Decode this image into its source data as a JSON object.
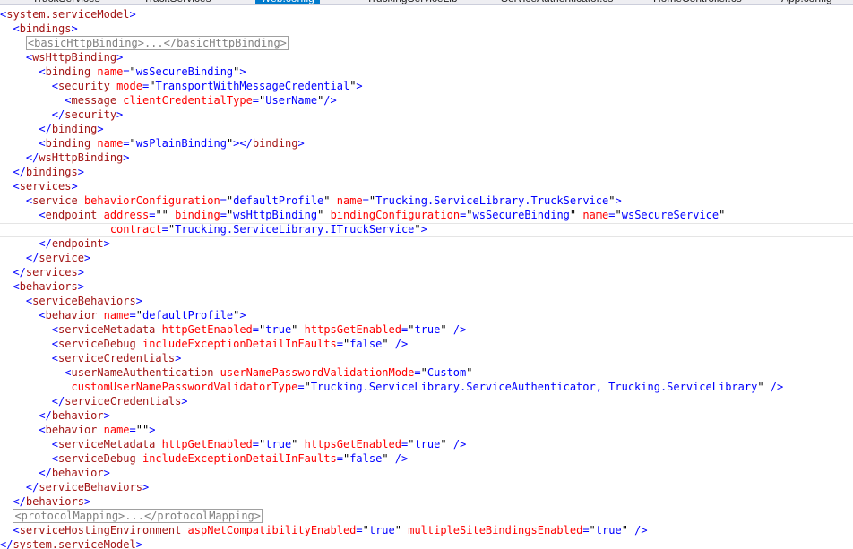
{
  "tabs": [
    {
      "label": "TruckServices",
      "active": false
    },
    {
      "label": "TrackServices",
      "active": false
    },
    {
      "label": "Web.config",
      "active": true
    },
    {
      "label": "TruckingServiceLib",
      "active": false
    },
    {
      "label": "ServiceAuthenticator.cs",
      "active": false
    },
    {
      "label": "HomeController.cs",
      "active": false
    },
    {
      "label": "App.config",
      "active": false
    }
  ],
  "code_lines": [
    [
      [
        "dl",
        "<"
      ],
      [
        "tg",
        "system.serviceModel"
      ],
      [
        "dl",
        ">"
      ]
    ],
    [
      [
        "sp",
        "  "
      ],
      [
        "dl",
        "<"
      ],
      [
        "tg",
        "bindings"
      ],
      [
        "dl",
        ">"
      ]
    ],
    [
      [
        "sp",
        "    "
      ],
      [
        "co",
        "<basicHttpBinding>...</basicHttpBinding>"
      ]
    ],
    [
      [
        "sp",
        "    "
      ],
      [
        "dl",
        "<"
      ],
      [
        "tg",
        "wsHttpBinding"
      ],
      [
        "dl",
        ">"
      ]
    ],
    [
      [
        "sp",
        "      "
      ],
      [
        "dl",
        "<"
      ],
      [
        "tg",
        "binding"
      ],
      [
        "sp",
        " "
      ],
      [
        "at",
        "name"
      ],
      [
        "eq",
        "="
      ],
      [
        "tx",
        "\""
      ],
      [
        "vl",
        "wsSecureBinding"
      ],
      [
        "tx",
        "\""
      ],
      [
        "dl",
        ">"
      ]
    ],
    [
      [
        "sp",
        "        "
      ],
      [
        "dl",
        "<"
      ],
      [
        "tg",
        "security"
      ],
      [
        "sp",
        " "
      ],
      [
        "at",
        "mode"
      ],
      [
        "eq",
        "="
      ],
      [
        "tx",
        "\""
      ],
      [
        "vl",
        "TransportWithMessageCredential"
      ],
      [
        "tx",
        "\""
      ],
      [
        "dl",
        ">"
      ]
    ],
    [
      [
        "sp",
        "          "
      ],
      [
        "dl",
        "<"
      ],
      [
        "tg",
        "message"
      ],
      [
        "sp",
        " "
      ],
      [
        "at",
        "clientCredentialType"
      ],
      [
        "eq",
        "="
      ],
      [
        "tx",
        "\""
      ],
      [
        "vl",
        "UserName"
      ],
      [
        "tx",
        "\""
      ],
      [
        "dl",
        "/>"
      ]
    ],
    [
      [
        "sp",
        "        "
      ],
      [
        "dl",
        "</"
      ],
      [
        "tg",
        "security"
      ],
      [
        "dl",
        ">"
      ]
    ],
    [
      [
        "sp",
        "      "
      ],
      [
        "dl",
        "</"
      ],
      [
        "tg",
        "binding"
      ],
      [
        "dl",
        ">"
      ]
    ],
    [
      [
        "sp",
        "      "
      ],
      [
        "dl",
        "<"
      ],
      [
        "tg",
        "binding"
      ],
      [
        "sp",
        " "
      ],
      [
        "at",
        "name"
      ],
      [
        "eq",
        "="
      ],
      [
        "tx",
        "\""
      ],
      [
        "vl",
        "wsPlainBinding"
      ],
      [
        "tx",
        "\""
      ],
      [
        "dl",
        "></"
      ],
      [
        "tg",
        "binding"
      ],
      [
        "dl",
        ">"
      ]
    ],
    [
      [
        "sp",
        "    "
      ],
      [
        "dl",
        "</"
      ],
      [
        "tg",
        "wsHttpBinding"
      ],
      [
        "dl",
        ">"
      ]
    ],
    [
      [
        "sp",
        "  "
      ],
      [
        "dl",
        "</"
      ],
      [
        "tg",
        "bindings"
      ],
      [
        "dl",
        ">"
      ]
    ],
    [
      [
        "sp",
        "  "
      ],
      [
        "dl",
        "<"
      ],
      [
        "tg",
        "services"
      ],
      [
        "dl",
        ">"
      ]
    ],
    [
      [
        "sp",
        "    "
      ],
      [
        "dl",
        "<"
      ],
      [
        "tg",
        "service"
      ],
      [
        "sp",
        " "
      ],
      [
        "at",
        "behaviorConfiguration"
      ],
      [
        "eq",
        "="
      ],
      [
        "tx",
        "\""
      ],
      [
        "vl",
        "defaultProfile"
      ],
      [
        "tx",
        "\""
      ],
      [
        "sp",
        " "
      ],
      [
        "at",
        "name"
      ],
      [
        "eq",
        "="
      ],
      [
        "tx",
        "\""
      ],
      [
        "vl",
        "Trucking.ServiceLibrary.TruckService"
      ],
      [
        "tx",
        "\""
      ],
      [
        "dl",
        ">"
      ]
    ],
    [
      [
        "sp",
        "      "
      ],
      [
        "dl",
        "<"
      ],
      [
        "tg",
        "endpoint"
      ],
      [
        "sp",
        " "
      ],
      [
        "at",
        "address"
      ],
      [
        "eq",
        "="
      ],
      [
        "tx",
        "\"\""
      ],
      [
        "sp",
        " "
      ],
      [
        "at",
        "binding"
      ],
      [
        "eq",
        "="
      ],
      [
        "tx",
        "\""
      ],
      [
        "vl",
        "wsHttpBinding"
      ],
      [
        "tx",
        "\""
      ],
      [
        "sp",
        " "
      ],
      [
        "at",
        "bindingConfiguration"
      ],
      [
        "eq",
        "="
      ],
      [
        "tx",
        "\""
      ],
      [
        "vl",
        "wsSecureBinding"
      ],
      [
        "tx",
        "\""
      ],
      [
        "sp",
        " "
      ],
      [
        "at",
        "name"
      ],
      [
        "eq",
        "="
      ],
      [
        "tx",
        "\""
      ],
      [
        "vl",
        "wsSecureService"
      ],
      [
        "tx",
        "\""
      ]
    ],
    [
      [
        "sp",
        "                 "
      ],
      [
        "at",
        "contract"
      ],
      [
        "eq",
        "="
      ],
      [
        "tx",
        "\""
      ],
      [
        "vl",
        "Trucking.ServiceLibrary.ITruckService"
      ],
      [
        "tx",
        "\""
      ],
      [
        "dl",
        ">"
      ]
    ],
    [
      [
        "sp",
        "      "
      ],
      [
        "dl",
        "</"
      ],
      [
        "tg",
        "endpoint"
      ],
      [
        "dl",
        ">"
      ]
    ],
    [
      [
        "sp",
        "    "
      ],
      [
        "dl",
        "</"
      ],
      [
        "tg",
        "service"
      ],
      [
        "dl",
        ">"
      ]
    ],
    [
      [
        "sp",
        "  "
      ],
      [
        "dl",
        "</"
      ],
      [
        "tg",
        "services"
      ],
      [
        "dl",
        ">"
      ]
    ],
    [
      [
        "sp",
        "  "
      ],
      [
        "dl",
        "<"
      ],
      [
        "tg",
        "behaviors"
      ],
      [
        "dl",
        ">"
      ]
    ],
    [
      [
        "sp",
        "    "
      ],
      [
        "dl",
        "<"
      ],
      [
        "tg",
        "serviceBehaviors"
      ],
      [
        "dl",
        ">"
      ]
    ],
    [
      [
        "sp",
        "      "
      ],
      [
        "dl",
        "<"
      ],
      [
        "tg",
        "behavior"
      ],
      [
        "sp",
        " "
      ],
      [
        "at",
        "name"
      ],
      [
        "eq",
        "="
      ],
      [
        "tx",
        "\""
      ],
      [
        "vl",
        "defaultProfile"
      ],
      [
        "tx",
        "\""
      ],
      [
        "dl",
        ">"
      ]
    ],
    [
      [
        "sp",
        "        "
      ],
      [
        "dl",
        "<"
      ],
      [
        "tg",
        "serviceMetadata"
      ],
      [
        "sp",
        " "
      ],
      [
        "at",
        "httpGetEnabled"
      ],
      [
        "eq",
        "="
      ],
      [
        "tx",
        "\""
      ],
      [
        "vl",
        "true"
      ],
      [
        "tx",
        "\""
      ],
      [
        "sp",
        " "
      ],
      [
        "at",
        "httpsGetEnabled"
      ],
      [
        "eq",
        "="
      ],
      [
        "tx",
        "\""
      ],
      [
        "vl",
        "true"
      ],
      [
        "tx",
        "\""
      ],
      [
        "sp",
        " "
      ],
      [
        "dl",
        "/>"
      ]
    ],
    [
      [
        "sp",
        "        "
      ],
      [
        "dl",
        "<"
      ],
      [
        "tg",
        "serviceDebug"
      ],
      [
        "sp",
        " "
      ],
      [
        "at",
        "includeExceptionDetailInFaults"
      ],
      [
        "eq",
        "="
      ],
      [
        "tx",
        "\""
      ],
      [
        "vl",
        "false"
      ],
      [
        "tx",
        "\""
      ],
      [
        "sp",
        " "
      ],
      [
        "dl",
        "/>"
      ]
    ],
    [
      [
        "sp",
        "        "
      ],
      [
        "dl",
        "<"
      ],
      [
        "tg",
        "serviceCredentials"
      ],
      [
        "dl",
        ">"
      ]
    ],
    [
      [
        "sp",
        "          "
      ],
      [
        "dl",
        "<"
      ],
      [
        "tg",
        "userNameAuthentication"
      ],
      [
        "sp",
        " "
      ],
      [
        "at",
        "userNamePasswordValidationMode"
      ],
      [
        "eq",
        "="
      ],
      [
        "tx",
        "\""
      ],
      [
        "vl",
        "Custom"
      ],
      [
        "tx",
        "\""
      ]
    ],
    [
      [
        "sp",
        "           "
      ],
      [
        "at",
        "customUserNamePasswordValidatorType"
      ],
      [
        "eq",
        "="
      ],
      [
        "tx",
        "\""
      ],
      [
        "vl",
        "Trucking.ServiceLibrary.ServiceAuthenticator, Trucking.ServiceLibrary"
      ],
      [
        "tx",
        "\""
      ],
      [
        "sp",
        " "
      ],
      [
        "dl",
        "/>"
      ]
    ],
    [
      [
        "sp",
        "        "
      ],
      [
        "dl",
        "</"
      ],
      [
        "tg",
        "serviceCredentials"
      ],
      [
        "dl",
        ">"
      ]
    ],
    [
      [
        "sp",
        "      "
      ],
      [
        "dl",
        "</"
      ],
      [
        "tg",
        "behavior"
      ],
      [
        "dl",
        ">"
      ]
    ],
    [
      [
        "sp",
        "      "
      ],
      [
        "dl",
        "<"
      ],
      [
        "tg",
        "behavior"
      ],
      [
        "sp",
        " "
      ],
      [
        "at",
        "name"
      ],
      [
        "eq",
        "="
      ],
      [
        "tx",
        "\"\""
      ],
      [
        "dl",
        ">"
      ]
    ],
    [
      [
        "sp",
        "        "
      ],
      [
        "dl",
        "<"
      ],
      [
        "tg",
        "serviceMetadata"
      ],
      [
        "sp",
        " "
      ],
      [
        "at",
        "httpGetEnabled"
      ],
      [
        "eq",
        "="
      ],
      [
        "tx",
        "\""
      ],
      [
        "vl",
        "true"
      ],
      [
        "tx",
        "\""
      ],
      [
        "sp",
        " "
      ],
      [
        "at",
        "httpsGetEnabled"
      ],
      [
        "eq",
        "="
      ],
      [
        "tx",
        "\""
      ],
      [
        "vl",
        "true"
      ],
      [
        "tx",
        "\""
      ],
      [
        "sp",
        " "
      ],
      [
        "dl",
        "/>"
      ]
    ],
    [
      [
        "sp",
        "        "
      ],
      [
        "dl",
        "<"
      ],
      [
        "tg",
        "serviceDebug"
      ],
      [
        "sp",
        " "
      ],
      [
        "at",
        "includeExceptionDetailInFaults"
      ],
      [
        "eq",
        "="
      ],
      [
        "tx",
        "\""
      ],
      [
        "vl",
        "false"
      ],
      [
        "tx",
        "\""
      ],
      [
        "sp",
        " "
      ],
      [
        "dl",
        "/>"
      ]
    ],
    [
      [
        "sp",
        "      "
      ],
      [
        "dl",
        "</"
      ],
      [
        "tg",
        "behavior"
      ],
      [
        "dl",
        ">"
      ]
    ],
    [
      [
        "sp",
        "    "
      ],
      [
        "dl",
        "</"
      ],
      [
        "tg",
        "serviceBehaviors"
      ],
      [
        "dl",
        ">"
      ]
    ],
    [
      [
        "sp",
        "  "
      ],
      [
        "dl",
        "</"
      ],
      [
        "tg",
        "behaviors"
      ],
      [
        "dl",
        ">"
      ]
    ],
    [
      [
        "sp",
        "  "
      ],
      [
        "co",
        "<protocolMapping>...</protocolMapping>"
      ]
    ],
    [
      [
        "sp",
        "  "
      ],
      [
        "dl",
        "<"
      ],
      [
        "tg",
        "serviceHostingEnvironment"
      ],
      [
        "sp",
        " "
      ],
      [
        "at",
        "aspNetCompatibilityEnabled"
      ],
      [
        "eq",
        "="
      ],
      [
        "tx",
        "\""
      ],
      [
        "vl",
        "true"
      ],
      [
        "tx",
        "\""
      ],
      [
        "sp",
        " "
      ],
      [
        "at",
        "multipleSiteBindingsEnabled"
      ],
      [
        "eq",
        "="
      ],
      [
        "tx",
        "\""
      ],
      [
        "vl",
        "true"
      ],
      [
        "tx",
        "\""
      ],
      [
        "sp",
        " "
      ],
      [
        "dl",
        "/>"
      ]
    ],
    [
      [
        "dl",
        "</"
      ],
      [
        "tg",
        "system.serviceModel"
      ],
      [
        "dl",
        ">"
      ]
    ]
  ]
}
